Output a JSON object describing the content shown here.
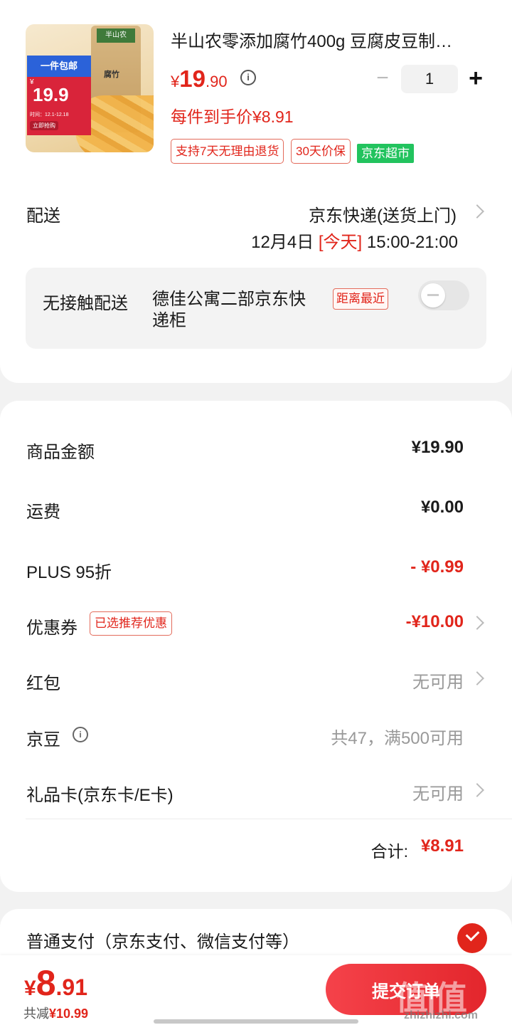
{
  "product": {
    "title": "半山农零添加腐竹400g 豆腐皮豆制…",
    "price": {
      "currency": "¥",
      "integer": "19",
      "decimal": ".90"
    },
    "quantity": "1",
    "per_item_price": "每件到手价¥8.91",
    "tags": [
      "支持7天无理由退货",
      "30天价保"
    ],
    "store_tag": "京东超市",
    "image": {
      "promo_top": "一件包邮",
      "promo_currency": "¥",
      "promo_price": "19.9",
      "promo_date": "时间：12.1-12.18",
      "promo_buy": "立即抢购",
      "bag_brand": "半山农",
      "bag_name": "腐竹"
    }
  },
  "delivery": {
    "label": "配送",
    "method": "京东快递(送货上门)",
    "date": "12月4日",
    "today": "[今天]",
    "time": "15:00-21:00",
    "contactless_label": "无接触配送",
    "address": "德佳公寓二部京东快递柜",
    "nearest_tag": "距离最近"
  },
  "summary": {
    "goods_amount": {
      "label": "商品金额",
      "value": "¥19.90"
    },
    "shipping": {
      "label": "运费",
      "value": "¥0.00"
    },
    "plus": {
      "label": "PLUS 95折",
      "value": "- ¥0.99"
    },
    "coupon": {
      "label": "优惠券",
      "tag": "已选推荐优惠",
      "value": "-¥10.00"
    },
    "red_packet": {
      "label": "红包",
      "value": "无可用"
    },
    "jd_beans": {
      "label": "京豆",
      "value": "共47，满500可用"
    },
    "gift_card": {
      "label": "礼品卡(京东卡/E卡)",
      "value": "无可用"
    },
    "total": {
      "label": "合计:",
      "value": "¥8.91"
    }
  },
  "payment": {
    "label": "普通支付（京东支付、微信支付等）"
  },
  "bottom": {
    "price": {
      "currency": "¥",
      "integer": "8",
      "decimal": ".91"
    },
    "saved_label": "共减",
    "saved_amount": "¥10.99",
    "submit_label": "提交订单",
    "watermark": "值|值",
    "watermark_sub": "zhizhizhi.com"
  },
  "colors": {
    "accent": "#e1251b",
    "store_tag": "#22c35e",
    "bg": "#f2f2f2"
  }
}
